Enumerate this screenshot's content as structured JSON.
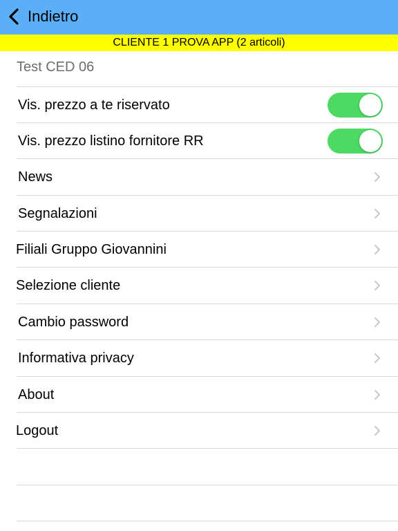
{
  "navbar": {
    "back_label": "Indietro",
    "color": "#5aaff7"
  },
  "banner": {
    "text": "CLIENTE 1 PROVA APP (2 articoli)",
    "color": "#ffff00"
  },
  "section_header": "Test CED 06",
  "toggles": [
    {
      "label": "Vis. prezzo a te riservato",
      "on": true
    },
    {
      "label": "Vis. prezzo listino fornitore RR",
      "on": true
    }
  ],
  "toggle_on_color": "#4cd964",
  "menu_items": [
    {
      "label": "News",
      "icon": "chevron-right-icon"
    },
    {
      "label": "Segnalazioni",
      "icon": "chevron-right-icon"
    },
    {
      "label": "Filiali Gruppo Giovannini",
      "icon": "chevron-right-icon"
    },
    {
      "label": "Selezione cliente",
      "icon": "chevron-right-icon"
    },
    {
      "label": "Cambio password",
      "icon": "chevron-right-icon"
    },
    {
      "label": "Informativa privacy",
      "icon": "chevron-right-icon"
    },
    {
      "label": "About",
      "icon": "chevron-right-icon"
    },
    {
      "label": "Logout",
      "icon": "chevron-right-icon"
    }
  ]
}
